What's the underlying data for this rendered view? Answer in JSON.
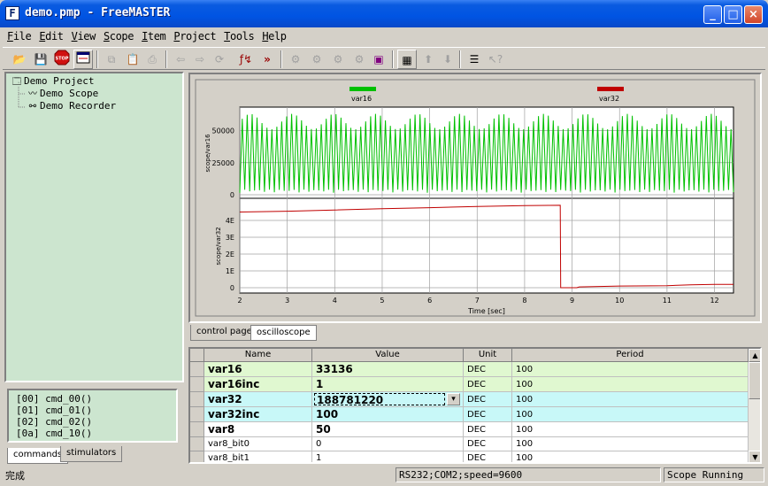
{
  "window": {
    "title": "demo.pmp - FreeMASTER",
    "icon": "F"
  },
  "menu": [
    "File",
    "Edit",
    "View",
    "Scope",
    "Item",
    "Project",
    "Tools",
    "Help"
  ],
  "toolbar_icons": [
    "open-icon",
    "save-icon",
    "stop-icon",
    "scope-settings-icon",
    "copy-icon",
    "paste-icon",
    "print-icon",
    "back-icon",
    "forward-icon",
    "refresh-icon",
    "variable-icon",
    "fast-forward-icon",
    "recorder-icon",
    "recorder-icon-2",
    "recorder-icon-3",
    "recorder-icon-4",
    "save-data-icon",
    "grid-icon",
    "up-arrow-icon",
    "down-arrow-icon",
    "properties-icon",
    "help-cursor-icon"
  ],
  "tree": {
    "root": "Demo Project",
    "items": [
      "Demo Scope",
      "Demo Recorder"
    ]
  },
  "commands": {
    "lines": [
      "[00] cmd_00()",
      "[01] cmd_01()",
      "[02] cmd_02()",
      "[0a] cmd_10()"
    ],
    "tabs": [
      "commands",
      "stimulators"
    ],
    "active_tab": "commands"
  },
  "chart_data": {
    "type": "line",
    "xlabel": "Time [sec]",
    "xlim": [
      2,
      12.4
    ],
    "x_ticks": [
      "2",
      "3",
      "4",
      "5",
      "6",
      "7",
      "8",
      "9",
      "10",
      "11",
      "12"
    ],
    "series": [
      {
        "name": "var16",
        "color": "#00c000",
        "ylabel": "scope/var16",
        "y_ticks": [
          "50000",
          "25000",
          "0"
        ],
        "ylim": [
          0,
          65535
        ],
        "waveform": "fast oscillating sawtooth between approx 0 and 65000"
      },
      {
        "name": "var32",
        "color": "#c00000",
        "ylabel": "scope/var32",
        "y_ticks": [
          "4E",
          "3E",
          "2E",
          "1E",
          "0"
        ],
        "ylim": [
          0,
          5
        ],
        "x": [
          2,
          3,
          4,
          5,
          6,
          7,
          8,
          8.75,
          8.76,
          9.1,
          9.15,
          10,
          11,
          11.5,
          12,
          12.4
        ],
        "y": [
          4.5,
          4.55,
          4.62,
          4.7,
          4.76,
          4.83,
          4.88,
          4.9,
          0.0,
          0.0,
          0.05,
          0.1,
          0.12,
          0.17,
          0.2,
          0.2
        ]
      }
    ]
  },
  "scope_tabs": [
    "control page",
    "oscilloscope"
  ],
  "active_scope_tab": "oscilloscope",
  "variables": {
    "headers": [
      "Name",
      "Value",
      "Unit",
      "Period"
    ],
    "rows": [
      {
        "name": "var16",
        "value": "33136",
        "unit": "DEC",
        "period": "100",
        "style": "green",
        "big": true
      },
      {
        "name": "var16inc",
        "value": "1",
        "unit": "DEC",
        "period": "100",
        "style": "green",
        "big": true
      },
      {
        "name": "var32",
        "value": "188781220",
        "unit": "DEC",
        "period": "100",
        "style": "cyan",
        "big": true,
        "editing": true
      },
      {
        "name": "var32inc",
        "value": "100",
        "unit": "DEC",
        "period": "100",
        "style": "cyan",
        "big": true
      },
      {
        "name": "var8",
        "value": "50",
        "unit": "DEC",
        "period": "100",
        "style": "white",
        "big": true
      },
      {
        "name": "var8_bit0",
        "value": "0",
        "unit": "DEC",
        "period": "100",
        "style": "white",
        "big": false
      },
      {
        "name": "var8_bit1",
        "value": "1",
        "unit": "DEC",
        "period": "100",
        "style": "white",
        "big": false
      }
    ]
  },
  "status": {
    "left": "完成",
    "connection": "RS232;COM2;speed=9600",
    "state": "Scope Running"
  },
  "colors": {
    "row_green": "#e0f8d0",
    "row_cyan": "#c8f8f8",
    "row_white": "#ffffff",
    "panel_green": "#cce5cf"
  }
}
